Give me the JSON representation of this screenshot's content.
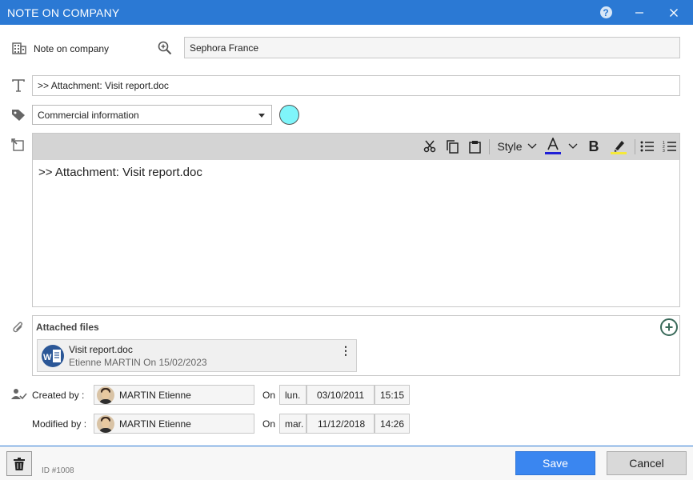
{
  "window": {
    "title": "NOTE ON COMPANY"
  },
  "note_on": {
    "label": "Note on company",
    "company": "Sephora France"
  },
  "subject": "&gt;&gt; Attachment: Visit report.doc",
  "category": {
    "value": "Commercial information",
    "color": "#7ff5fa"
  },
  "toolbar": {
    "style_label": "Style"
  },
  "editor": {
    "content": "&gt;&gt; Attachment: Visit report.doc"
  },
  "attachments": {
    "title": "Attached files",
    "files": [
      {
        "name": "Visit report.doc",
        "meta": "Etienne MARTIN On 15/02/2023"
      }
    ]
  },
  "created": {
    "label": "Created by :",
    "user": "MARTIN Etienne",
    "on": "On",
    "day": "lun.",
    "date": "03/10/2011",
    "time": "15:15"
  },
  "modified": {
    "label": "Modified by :",
    "user": "MARTIN Etienne",
    "on": "On",
    "day": "mar.",
    "date": "11/12/2018",
    "time": "14:26"
  },
  "footer": {
    "id": "ID #1008",
    "save": "Save",
    "cancel": "Cancel"
  },
  "colors": {
    "titlebar": "#2b79d4",
    "save": "#3a86f0",
    "font_color": "#1f1fd6",
    "highlight": "#f5e93a"
  },
  "icons": [
    "help-icon",
    "minimize-icon",
    "close-icon",
    "building-icon",
    "zoom-icon",
    "text-icon",
    "tag-icon",
    "note-edit-icon",
    "scissors-icon",
    "copy-icon",
    "paste-icon",
    "font-color-icon",
    "bold-icon",
    "highlight-icon",
    "bullet-list-icon",
    "numbered-list-icon",
    "paperclip-icon",
    "word-file-icon",
    "kebab-icon",
    "plus-circle-icon",
    "user-check-icon",
    "avatar",
    "trash-icon"
  ]
}
